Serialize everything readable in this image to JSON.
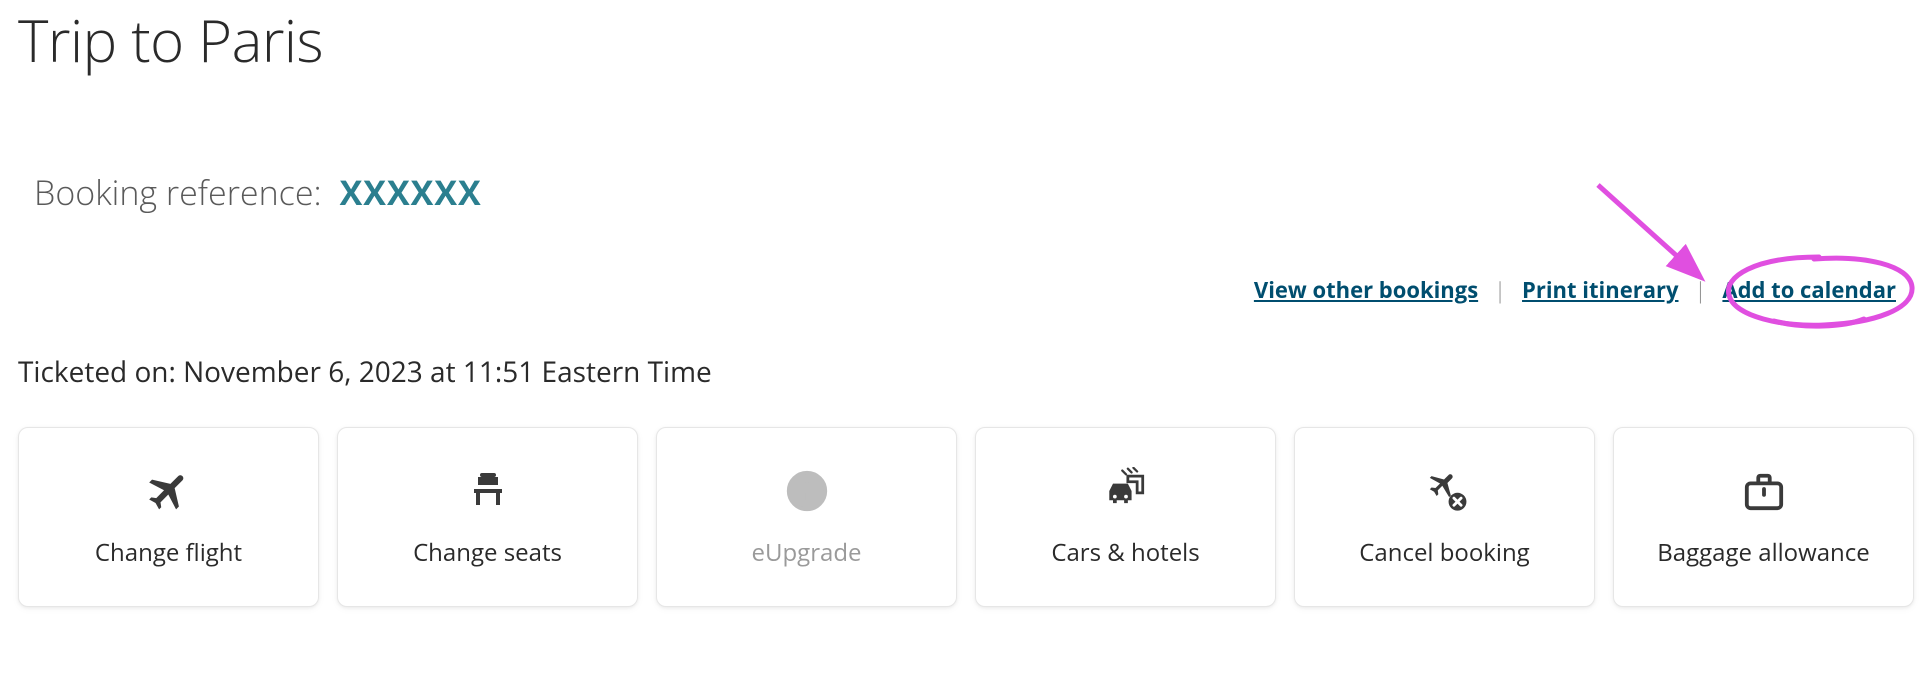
{
  "page_title": "Trip to Paris",
  "booking_reference": {
    "label": "Booking reference:",
    "value": "XXXXXX"
  },
  "links": {
    "view_other_bookings": "View other bookings",
    "print_itinerary": "Print itinerary",
    "add_to_calendar": "Add to calendar"
  },
  "ticketed_on": "Ticketed on: November 6, 2023 at 11:51 Eastern Time",
  "tiles": {
    "change_flight": "Change flight",
    "change_seats": "Change seats",
    "eupgrade": "eUpgrade",
    "cars_hotels": "Cars & hotels",
    "cancel_booking": "Cancel booking",
    "baggage_allowance": "Baggage allowance"
  },
  "colors": {
    "brand_teal": "#2b7f8f",
    "link_blue": "#004e6f",
    "annotation_pink": "#e04fe0"
  }
}
